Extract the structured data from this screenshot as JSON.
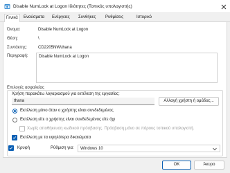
{
  "window": {
    "title": "Disable NumLock at Logon Ιδιότητες (Τοπικός υπολογιστής)"
  },
  "tabs": [
    {
      "label": "Γενικά",
      "active": true
    },
    {
      "label": "Εναύσματα",
      "active": false
    },
    {
      "label": "Ενέργειες",
      "active": false
    },
    {
      "label": "Συνθήκες",
      "active": false
    },
    {
      "label": "Ρυθμίσεις",
      "active": false
    },
    {
      "label": "Ιστορικό",
      "active": false
    }
  ],
  "general": {
    "name_label": "Όνομα:",
    "name_value": "Disable NumLock at Logon",
    "location_label": "Θέση:",
    "location_value": "\\",
    "author_label": "Συντάκτης:",
    "author_value": "CD2205NW\\thana",
    "description_label": "Περιγραφή:",
    "description_value": "Disable NumLock at Logon"
  },
  "security": {
    "section_title": "Επιλογές ασφαλείας",
    "run_as_prompt": "Χρήση παρακάτω λογαριασμού για εκτέλεση της εργασίας:",
    "user_account": "thana",
    "change_user_button": "Αλλαγή χρήστη ή ομάδας...",
    "option_logged_on": "Εκτέλεση μόνο όταν ο χρήστης είναι συνδεδεμένος",
    "option_logged_on_selected": true,
    "option_whether_or_not": "Εκτέλεση είτε ο χρήστης είναι συνδεδεμένος είτε όχι",
    "no_store_password": "Χωρίς αποθήκευση κωδικού πρόσβασης. Πρόσβαση μόνο σε πόρους τοπικού υπολογιστή.",
    "highest_privileges": "Εκτέλεση με τα υψηλότερα δικαιώματα",
    "highest_privileges_checked": true
  },
  "bottom": {
    "hidden_label": "Κρυφή",
    "hidden_checked": true,
    "configure_label": "Ρύθμιση για:",
    "configure_value": "Windows 10"
  },
  "footer": {
    "ok_label": "OK",
    "cancel_label": "Άκυρο"
  },
  "colors": {
    "accent": "#0a5fb4",
    "background": "#f0f0f0",
    "panel": "#ffffff"
  }
}
